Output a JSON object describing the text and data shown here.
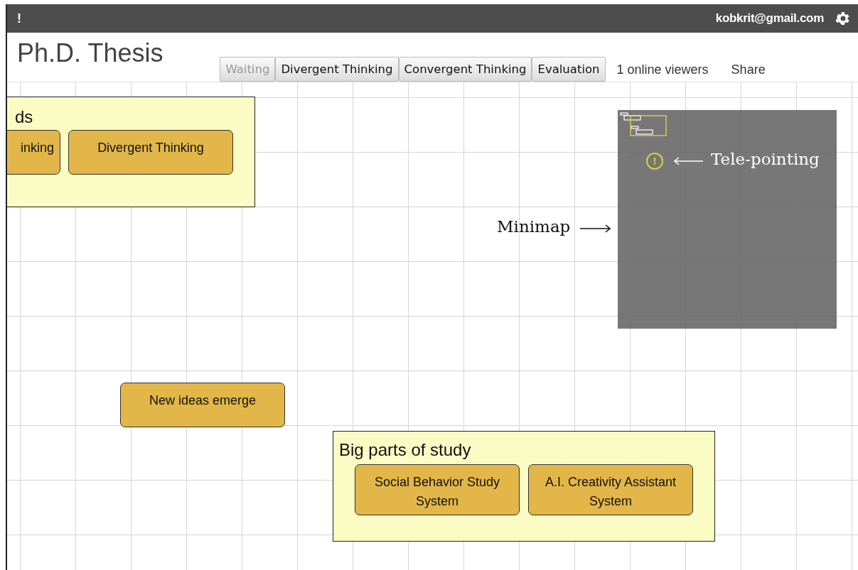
{
  "topbar": {
    "mark": "!",
    "user": "kobkrit@gmail.com"
  },
  "title": "Ph.D. Thesis",
  "tabs": [
    {
      "label": "Waiting",
      "disabled": true
    },
    {
      "label": "Divergent Thinking",
      "disabled": false
    },
    {
      "label": "Convergent Thinking",
      "disabled": false
    },
    {
      "label": "Evaluation",
      "disabled": false
    }
  ],
  "viewers": "1 online viewers",
  "share": "Share",
  "canvas": {
    "groups": [
      {
        "title": "ds",
        "nodes": [
          "inking",
          "Divergent Thinking"
        ]
      },
      {
        "title": "Big parts of study",
        "nodes": [
          "Social Behavior Study System",
          "A.I. Creativity Assistant System"
        ]
      }
    ],
    "nodes": [
      "New ideas emerge"
    ]
  },
  "minimap": {
    "pointer": "!"
  },
  "annotations": [
    {
      "label": "Tele-pointing",
      "kind": "left"
    },
    {
      "label": "Minimap",
      "kind": "right"
    }
  ]
}
